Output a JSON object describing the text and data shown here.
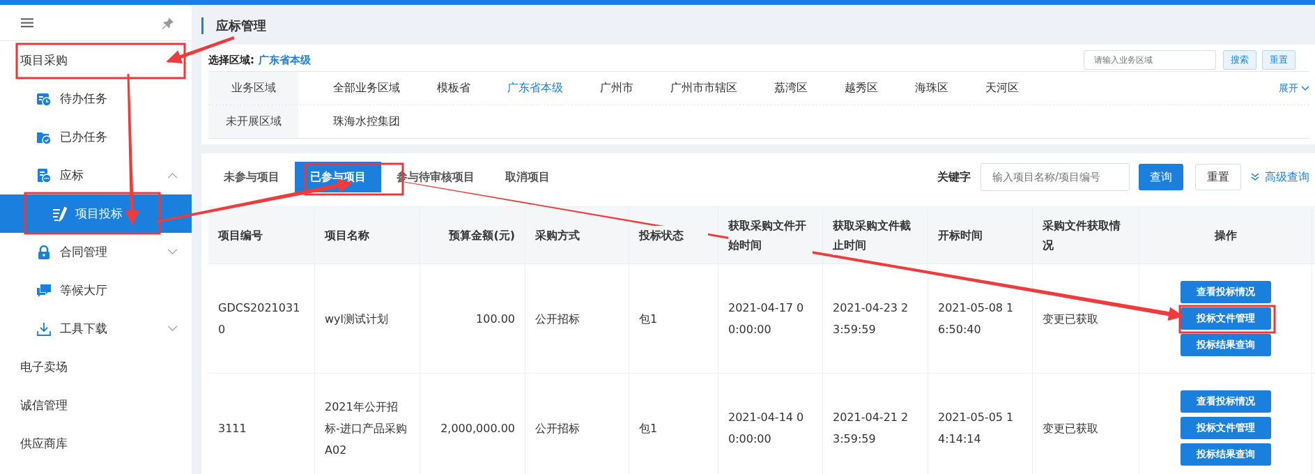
{
  "sidebar": {
    "items": [
      {
        "label": "项目采购",
        "expanded": true,
        "selected": false,
        "children": [
          {
            "label": "待办任务",
            "selected": false
          },
          {
            "label": "已办任务",
            "selected": false
          },
          {
            "label": "应标",
            "expanded": true,
            "selected": false,
            "children": [
              {
                "label": "项目投标",
                "selected": true
              }
            ]
          },
          {
            "label": "合同管理",
            "expanded": false,
            "selected": false
          },
          {
            "label": "等候大厅",
            "selected": false
          },
          {
            "label": "工具下载",
            "expanded": false,
            "selected": false
          }
        ]
      },
      {
        "label": "电子卖场",
        "selected": false
      },
      {
        "label": "诚信管理",
        "selected": false
      },
      {
        "label": "供应商库",
        "selected": false
      }
    ]
  },
  "page_title": "应标管理",
  "region": {
    "label": "选择区域:",
    "current": "广东省本级",
    "search": {
      "placeholder": "请输入业务区域"
    },
    "buttons": [
      "搜索",
      "重置"
    ],
    "expand_link": "展开",
    "rows": [
      {
        "label": "业务区域",
        "options": [
          {
            "text": "全部业务区域",
            "selected": false
          },
          {
            "text": "模板省",
            "selected": false
          },
          {
            "text": "广东省本级",
            "selected": true
          },
          {
            "text": "广州市",
            "selected": false
          },
          {
            "text": "广州市市辖区",
            "selected": false
          },
          {
            "text": "荔湾区",
            "selected": false
          },
          {
            "text": "越秀区",
            "selected": false
          },
          {
            "text": "海珠区",
            "selected": false
          },
          {
            "text": "天河区",
            "selected": false
          }
        ]
      },
      {
        "label": "未开展区域",
        "options": [
          {
            "text": "珠海水控集团",
            "selected": false
          }
        ]
      }
    ]
  },
  "tabs": [
    {
      "label": "未参与项目",
      "selected": false
    },
    {
      "label": "已参与项目",
      "selected": true
    },
    {
      "label": "参与待审核项目",
      "selected": false
    },
    {
      "label": "取消项目",
      "selected": false
    }
  ],
  "filter": {
    "label": "关键字",
    "placeholder": "输入项目名称/项目编号",
    "query_button": "查询",
    "reset_button": "重置",
    "advanced_link": "高级查询"
  },
  "table": {
    "columns": [
      {
        "label": "项目编号"
      },
      {
        "label": "项目名称"
      },
      {
        "label": "预算金额(元)"
      },
      {
        "label": "采购方式"
      },
      {
        "label": "投标状态"
      },
      {
        "label": "获取采购文件开始时间"
      },
      {
        "label": "获取采购文件截止时间"
      },
      {
        "label": "开标时间"
      },
      {
        "label": "采购文件获取情况"
      },
      {
        "label": "操作"
      }
    ],
    "rows": [
      {
        "cells": [
          "GDCS20210310",
          "wyl测试计划",
          "100.00",
          "公开招标",
          "包1",
          "2021-04-17 00:00:00",
          "2021-04-23 23:59:59",
          "2021-05-08 16:50:40",
          "变更已获取"
        ],
        "actions": [
          "查看投标情况",
          "投标文件管理",
          "投标结果查询"
        ]
      },
      {
        "cells": [
          "3111",
          "2021年公开招标-进口产品采购A02",
          "2,000,000.00",
          "公开招标",
          "包1",
          "2021-04-14 00:00:00",
          "2021-04-21 23:59:59",
          "2021-05-05 14:14:14",
          "变更已获取"
        ],
        "actions": [
          "查看投标情况",
          "投标文件管理",
          "投标结果查询"
        ]
      }
    ]
  }
}
